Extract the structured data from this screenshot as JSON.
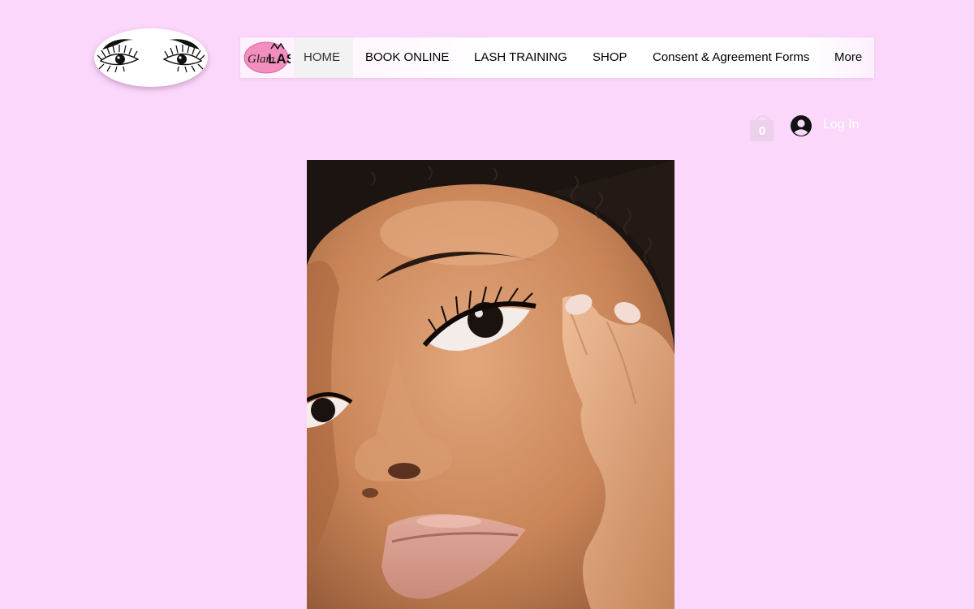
{
  "brand": {
    "eye_logo_icon": "lash-eyes-logo-icon",
    "nav_logo_icon": "glam-lash-logo-icon",
    "nav_logo_text": [
      "Glam",
      "LASH"
    ],
    "accent_color": "#fbd7fb"
  },
  "nav": {
    "items": [
      {
        "label": "HOME",
        "active": true
      },
      {
        "label": "BOOK ONLINE"
      },
      {
        "label": "LASH TRAINING"
      },
      {
        "label": "SHOP"
      },
      {
        "label": "Consent & Agreement Forms"
      },
      {
        "label": "More"
      }
    ]
  },
  "header": {
    "cart_count": "0",
    "cart_icon": "shopping-bag-icon",
    "login_icon": "user-avatar-icon",
    "login_label": "Log In"
  },
  "hero": {
    "image": "woman-portrait-lashes-photo"
  }
}
